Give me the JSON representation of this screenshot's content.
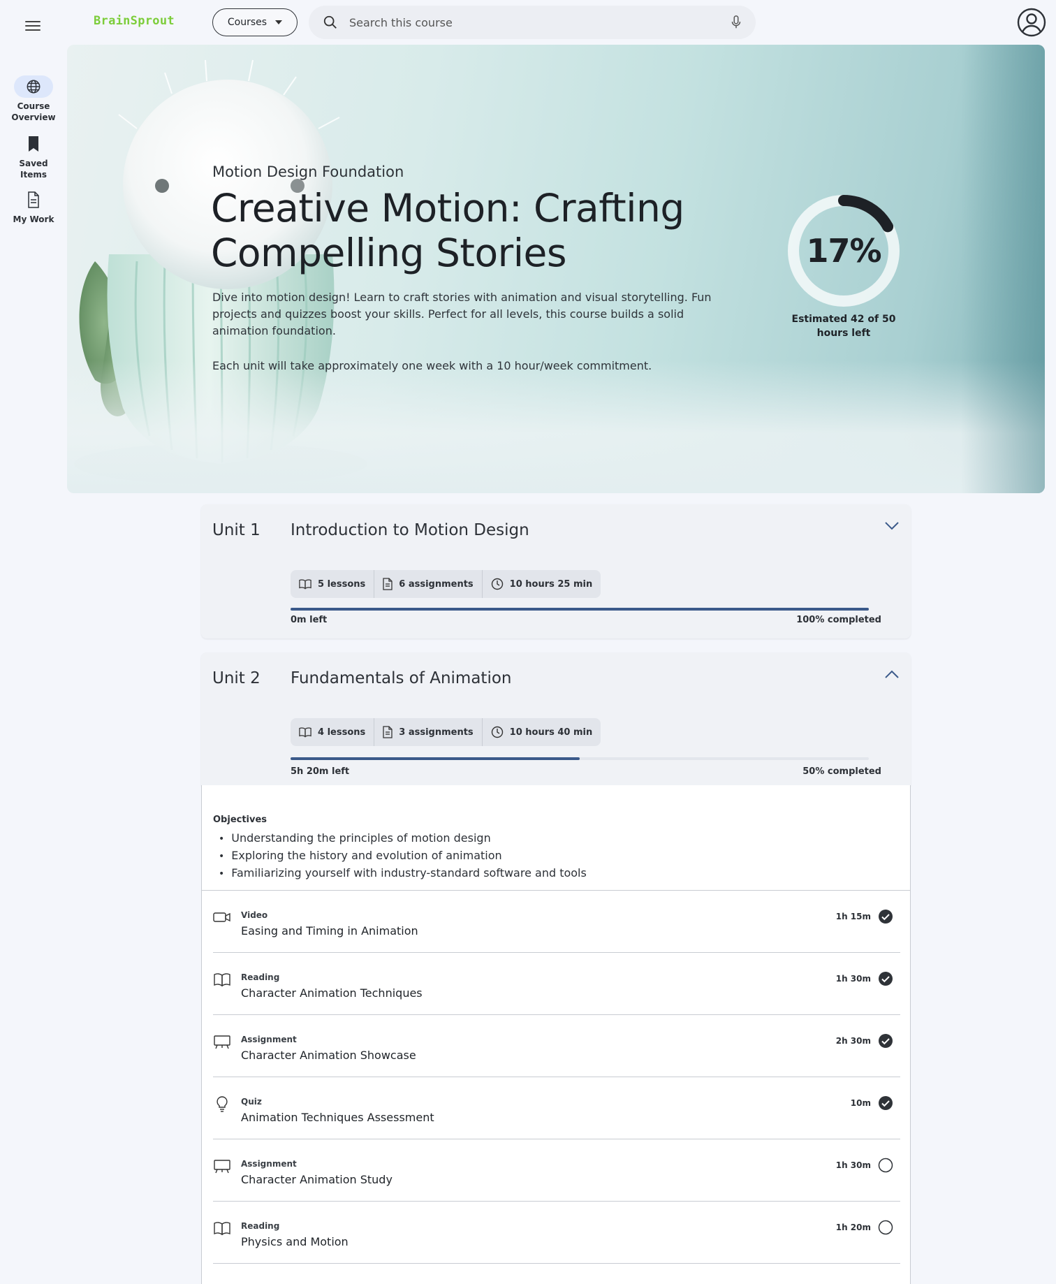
{
  "app": {
    "brand": "BrainSprout"
  },
  "header": {
    "courses_label": "Courses",
    "search_placeholder": "Search this course"
  },
  "nav": [
    {
      "label": "Course Overview",
      "icon": "globe-icon",
      "active": true
    },
    {
      "label": "Saved Items",
      "icon": "bookmark-icon",
      "active": false
    },
    {
      "label": "My Work",
      "icon": "document-icon",
      "active": false
    }
  ],
  "course": {
    "subtitle": "Motion Design Foundation",
    "title": "Creative Motion: Crafting Compelling  Stories",
    "description": "Dive into motion design! Learn to craft stories with animation and visual storytelling. Fun projects and quizzes boost your skills. Perfect for all levels, this course builds a solid animation foundation.",
    "commitment": "Each unit will take approximately one week with a 10 hour/week commitment.",
    "progress_percent": 17,
    "progress_label": "17%",
    "hours_left_caption": "Estimated 42 of 50 hours left"
  },
  "units": [
    {
      "number": "Unit 1",
      "title": "Introduction to Motion Design",
      "lessons": "5 lessons",
      "assignments": "6 assignments",
      "duration": "10 hours 25 min",
      "time_left": "0m left",
      "completed_label": "100% completed",
      "completed_fraction": 1.0,
      "expanded": false
    },
    {
      "number": "Unit 2",
      "title": "Fundamentals of Animation",
      "lessons": "4 lessons",
      "assignments": "3 assignments",
      "duration": "10 hours 40 min",
      "time_left": "5h 20m left",
      "completed_label": "50% completed",
      "completed_fraction": 0.5,
      "expanded": true
    }
  ],
  "unit2_details": {
    "objectives_heading": "Objectives",
    "objectives": [
      "Understanding the principles of motion design",
      "Exploring the history and evolution of animation",
      "Familiarizing yourself with industry-standard software and tools"
    ],
    "items": [
      {
        "type": "Video",
        "title": "Easing and Timing in Animation",
        "duration": "1h 15m",
        "done": true,
        "icon": "video-icon"
      },
      {
        "type": "Reading",
        "title": "Character Animation Techniques",
        "duration": "1h 30m",
        "done": true,
        "icon": "book-icon"
      },
      {
        "type": "Assignment",
        "title": "Character Animation Showcase",
        "duration": "2h 30m",
        "done": true,
        "icon": "easel-icon"
      },
      {
        "type": "Quiz",
        "title": "Animation Techniques Assessment",
        "duration": "10m",
        "done": true,
        "icon": "lightbulb-icon"
      },
      {
        "type": "Assignment",
        "title": "Character Animation Study",
        "duration": "1h 30m",
        "done": false,
        "icon": "easel-icon"
      },
      {
        "type": "Reading",
        "title": "Physics and Motion",
        "duration": "1h 20m",
        "done": false,
        "icon": "book-icon"
      }
    ]
  },
  "colors": {
    "brand": "#7ccd3a",
    "progress": "#3b5a8a",
    "ring": "#1d2126"
  }
}
